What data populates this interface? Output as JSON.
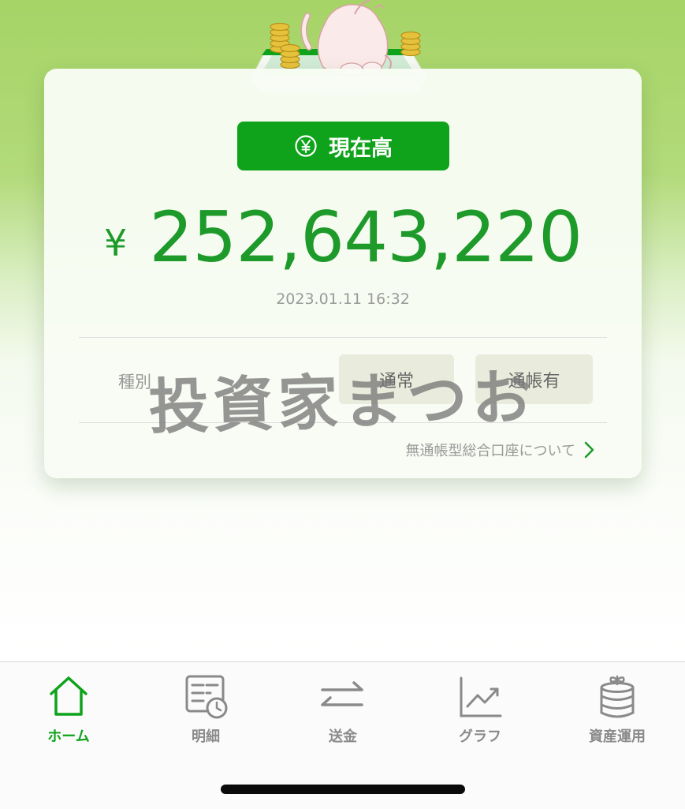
{
  "card": {
    "label": "現在高",
    "currency_symbol": "¥",
    "amount": "252,643,220",
    "timestamp": "2023.01.11 16:32",
    "type_label": "種別",
    "type_chips": [
      "通常",
      "通帳有"
    ],
    "about_link": "無通帳型総合口座について"
  },
  "watermark": "投資家まつお",
  "tabs": [
    {
      "label": "ホーム",
      "icon": "home-icon",
      "active": true
    },
    {
      "label": "明細",
      "icon": "statement-icon",
      "active": false
    },
    {
      "label": "送金",
      "icon": "transfer-icon",
      "active": false
    },
    {
      "label": "グラフ",
      "icon": "graph-icon",
      "active": false
    },
    {
      "label": "資産運用",
      "icon": "asset-management-icon",
      "active": false
    }
  ],
  "colors": {
    "accent": "#0ea31a",
    "amount": "#1d9a2a",
    "muted": "#9a9a9a",
    "header_green": "#a6d466"
  }
}
